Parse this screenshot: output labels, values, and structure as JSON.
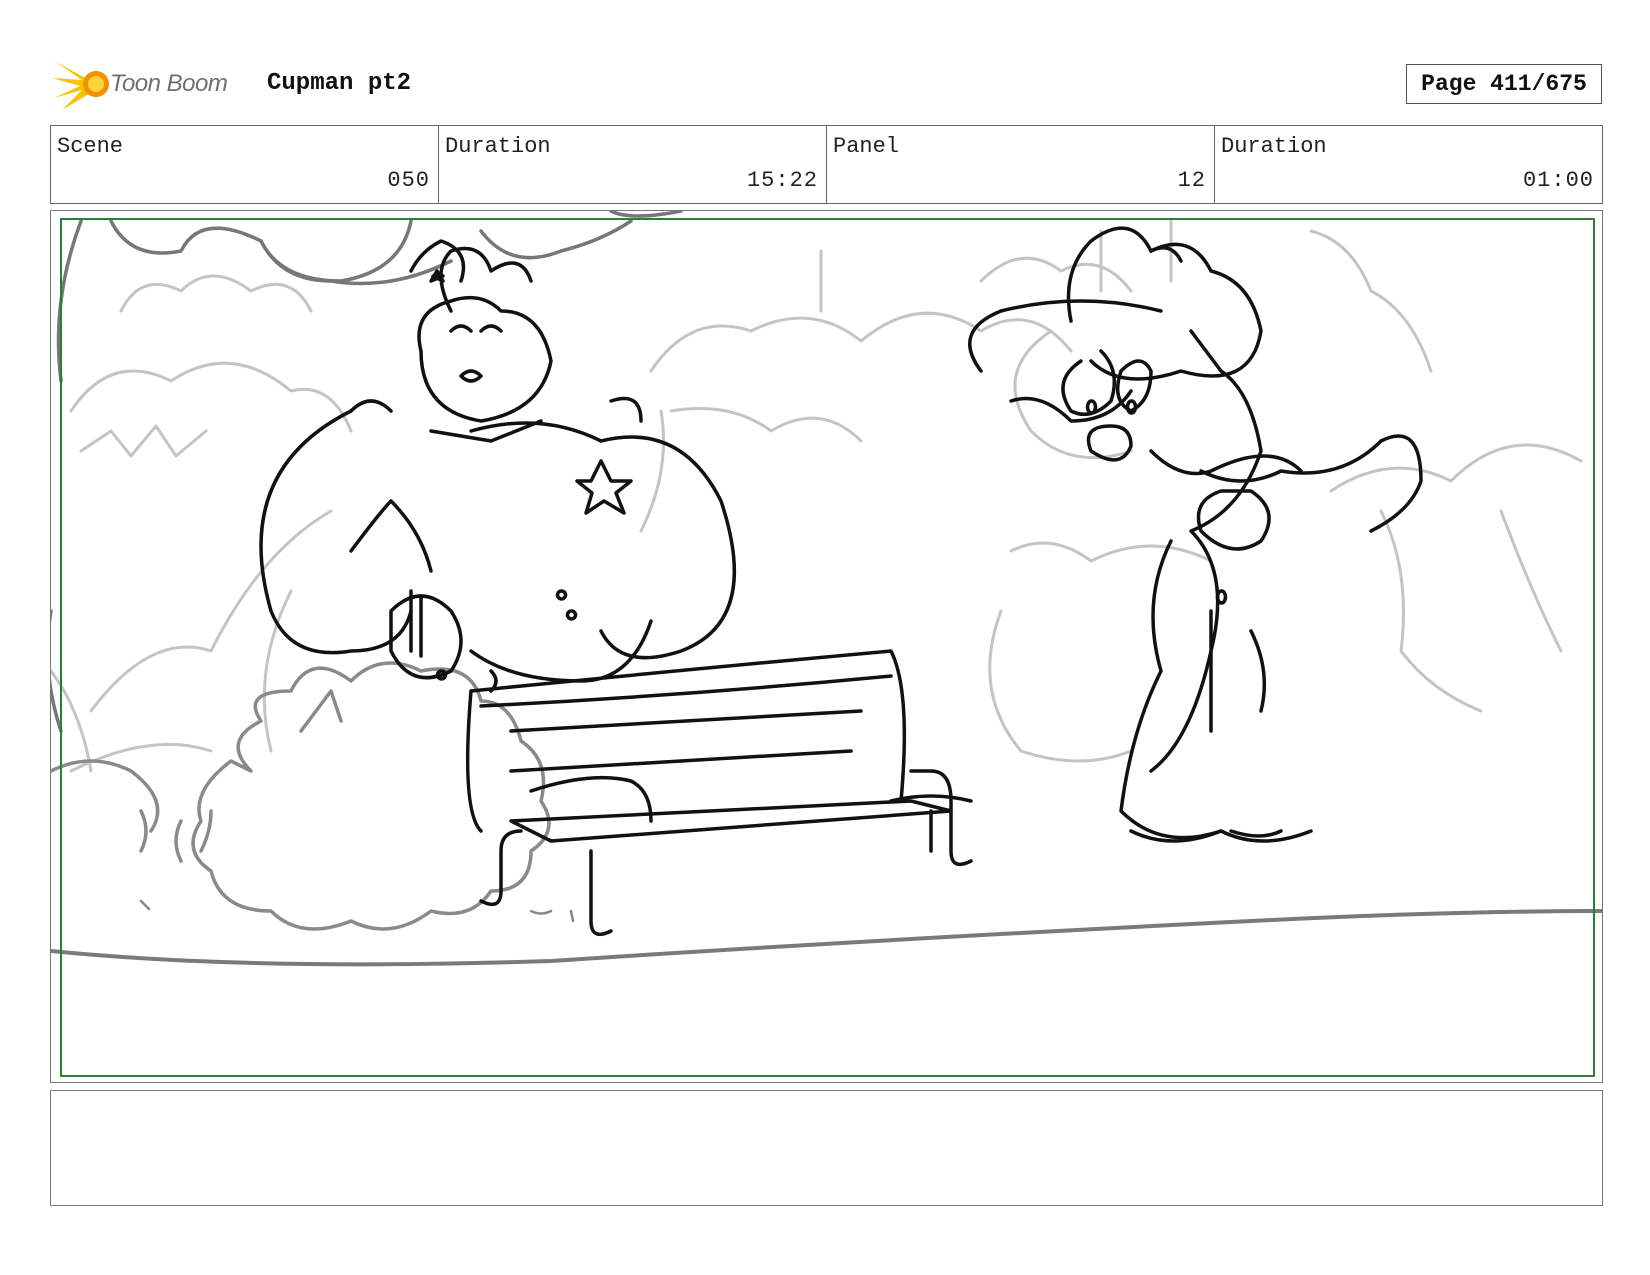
{
  "header": {
    "logo_text": "Toon Boom",
    "project_title": "Cupman pt2",
    "page_label": "Page 411/675"
  },
  "info": [
    {
      "label": "Scene",
      "value": "050"
    },
    {
      "label": "Duration",
      "value": "15:22"
    },
    {
      "label": "Panel",
      "value": "12"
    },
    {
      "label": "Duration",
      "value": "01:00"
    }
  ],
  "colors": {
    "safe_area": "#2e7d32",
    "logo_yellow": "#f5c400",
    "logo_orange": "#f29100"
  },
  "notes": {
    "text": ""
  }
}
